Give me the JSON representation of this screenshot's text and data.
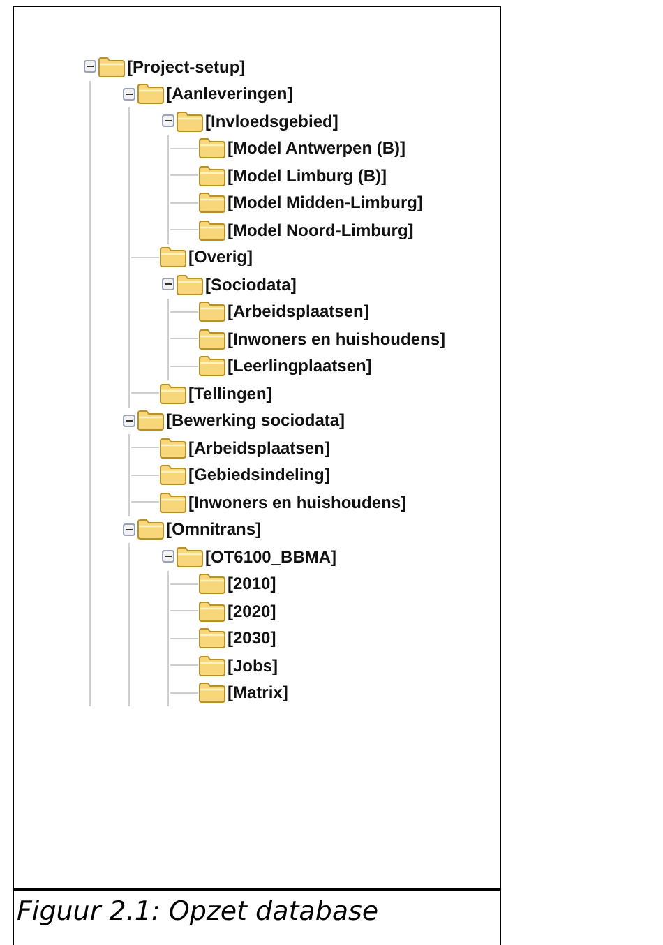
{
  "tree": [
    {
      "label": "[Project-setup]",
      "expanded": true,
      "children": [
        {
          "label": "[Aanleveringen]",
          "expanded": true,
          "children": [
            {
              "label": "[Invloedsgebied]",
              "expanded": true,
              "children": [
                {
                  "label": "[Model Antwerpen (B)]"
                },
                {
                  "label": "[Model Limburg (B)]"
                },
                {
                  "label": "[Model Midden-Limburg]"
                },
                {
                  "label": "[Model Noord-Limburg]"
                }
              ]
            },
            {
              "label": "[Overig]"
            },
            {
              "label": "[Sociodata]",
              "expanded": true,
              "children": [
                {
                  "label": "[Arbeidsplaatsen]"
                },
                {
                  "label": "[Inwoners en huishoudens]"
                },
                {
                  "label": "[Leerlingplaatsen]"
                }
              ]
            },
            {
              "label": "[Tellingen]"
            }
          ]
        },
        {
          "label": "[Bewerking sociodata]",
          "expanded": true,
          "children": [
            {
              "label": "[Arbeidsplaatsen]"
            },
            {
              "label": "[Gebiedsindeling]"
            },
            {
              "label": "[Inwoners en huishoudens]"
            }
          ]
        },
        {
          "label": "[Omnitrans]",
          "expanded": true,
          "children": [
            {
              "label": "[OT6100_BBMA]",
              "expanded": true,
              "children": [
                {
                  "label": "[2010]"
                },
                {
                  "label": "[2020]"
                },
                {
                  "label": "[2030]"
                },
                {
                  "label": "[Jobs]"
                },
                {
                  "label": "[Matrix]"
                }
              ]
            }
          ]
        }
      ]
    }
  ],
  "caption": "Figuur 2.1: Opzet database"
}
